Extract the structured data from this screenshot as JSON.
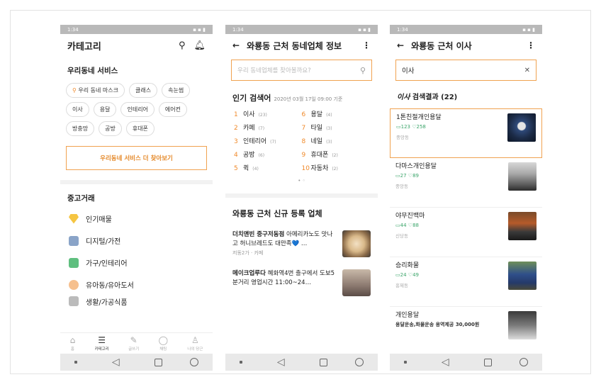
{
  "status_time": "1:34",
  "screen1": {
    "title": "카테고리",
    "neighborhood_services": {
      "title": "우리동네 서비스",
      "chips": [
        "우리 동네 마스크",
        "클래스",
        "속눈썹",
        "이사",
        "용달",
        "인테리어",
        "에어컨",
        "방충망",
        "공방",
        "휴대폰"
      ],
      "more_button": "우리동네 서비스 더 찾아보기"
    },
    "used_trade": {
      "title": "중고거래",
      "items": [
        "인기매물",
        "디지털/가전",
        "가구/인테리어",
        "유아동/유아도서",
        "생활/가공식품"
      ]
    },
    "tabs": [
      {
        "label": "홈",
        "icon": "home-icon"
      },
      {
        "label": "카테고리",
        "icon": "menu-icon"
      },
      {
        "label": "글쓰기",
        "icon": "pencil-icon"
      },
      {
        "label": "채팅",
        "icon": "chat-icon"
      },
      {
        "label": "나의 당근",
        "icon": "person-icon"
      }
    ]
  },
  "screen2": {
    "title": "와룡동 근처 동네업체 정보",
    "search_placeholder": "우리 동네업체를 찾아볼까요?",
    "popular_title": "인기 검색어",
    "popular_date": "2020년 03월 17일 09:00 기준",
    "popular": [
      {
        "rank": "1",
        "term": "이사",
        "count": "(23)"
      },
      {
        "rank": "6",
        "term": "용달",
        "count": "(4)"
      },
      {
        "rank": "2",
        "term": "카페",
        "count": "(7)"
      },
      {
        "rank": "7",
        "term": "타일",
        "count": "(3)"
      },
      {
        "rank": "3",
        "term": "인테리어",
        "count": "(7)"
      },
      {
        "rank": "8",
        "term": "네일",
        "count": "(3)"
      },
      {
        "rank": "4",
        "term": "공방",
        "count": "(6)"
      },
      {
        "rank": "9",
        "term": "휴대폰",
        "count": "(2)"
      },
      {
        "rank": "5",
        "term": "퀵",
        "count": "(4)"
      },
      {
        "rank": "10",
        "term": "자동차",
        "count": "(2)"
      }
    ],
    "pager_dots": "• ◦",
    "new_title": "와룡동 근처 신규 등록 업체",
    "new_businesses": [
      {
        "name": "더치앤빈 중구저동점",
        "desc": " 아메리카노도 맛나고 허니브레드도 대만족💙 …",
        "sub": "저동2가 · 카페"
      },
      {
        "name": "메이크업루다",
        "desc": " 혜화역4번 출구에서 도보5분거리 영업시간 11:00~24…",
        "sub": ""
      }
    ]
  },
  "screen3": {
    "title": "와룡동 근처 이사",
    "search_value": "이사",
    "result_term": "이사",
    "result_suffix": " 검색결과 (22)",
    "results": [
      {
        "name": "1톤친절개인용달",
        "comments": "123",
        "likes": "258",
        "loc": "중앙동"
      },
      {
        "name": "다마스개인용달",
        "comments": "27",
        "likes": "89",
        "loc": "중앙동"
      },
      {
        "name": "야무진백마",
        "comments": "44",
        "likes": "88",
        "loc": "신당동"
      },
      {
        "name": "승리화물",
        "comments": "24",
        "likes": "49",
        "loc": "흥제동"
      },
      {
        "name": "개인용달",
        "sub": "용달운송,화물운송 용역제공 30,000원",
        "comments": "",
        "likes": "",
        "loc": ""
      }
    ]
  }
}
